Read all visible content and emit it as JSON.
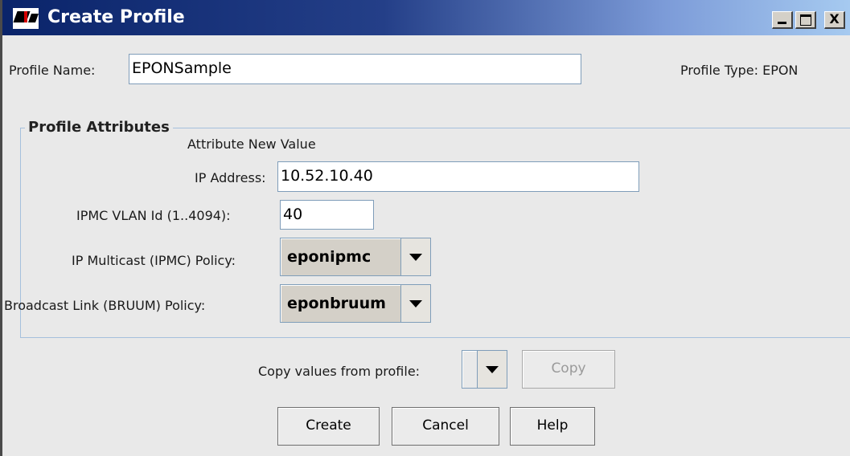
{
  "window": {
    "title": "Create Profile",
    "controls": {
      "minimize": "_",
      "maximize": "□",
      "close": "X"
    }
  },
  "profile": {
    "name_label": "Profile Name:",
    "name_value": "EPONSample",
    "type_label": "Profile Type:",
    "type_value": "EPON"
  },
  "attributes": {
    "group_title": "Profile Attributes",
    "header": "Attribute New Value",
    "ip_address": {
      "label": "IP Address:",
      "value": "10.52.10.40"
    },
    "ipmc_vlan": {
      "label": "IPMC VLAN Id (1..4094):",
      "value": "40"
    },
    "ipmc_policy": {
      "label": "IP Multicast (IPMC) Policy:",
      "value": "eponipmc"
    },
    "bruum_policy": {
      "label": "Broadcast Link (BRUUM) Policy:",
      "value": "eponbruum"
    }
  },
  "copy": {
    "label": "Copy values from profile:",
    "selected": "",
    "button": "Copy"
  },
  "actions": {
    "create": "Create",
    "cancel": "Cancel",
    "help": "Help"
  },
  "icons": {
    "app": "app-logo-icon",
    "dropdown": "chevron-down-icon"
  }
}
